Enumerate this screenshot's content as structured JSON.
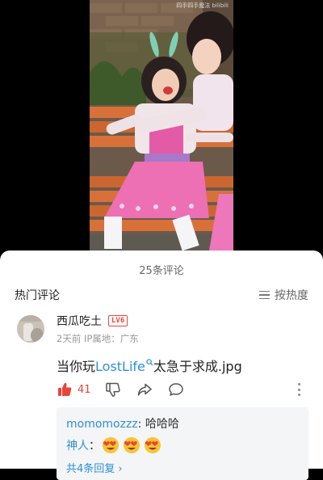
{
  "video": {
    "watermark": "四手四手魔法 bilibili"
  },
  "comments": {
    "count_title": "25条评论",
    "hot_label": "热门评论",
    "sort_label": "按热度",
    "top_comment": {
      "username": "西瓜吃土",
      "level_badge": "LV6",
      "meta": "2天前  IP属地：广东",
      "text_prefix": "当你玩",
      "link_text": "LostLife",
      "text_suffix": "太急于求成.jpg",
      "like_count": "41",
      "replies": [
        {
          "user": "momomozzz",
          "separator": ": ",
          "text": "哈哈哈"
        },
        {
          "user": "神人",
          "separator": "：",
          "emoji_count": 3
        }
      ],
      "more_replies": "共4条回复 ›"
    }
  },
  "colors": {
    "accent": "#e8453c",
    "link": "#2d8fd5"
  }
}
